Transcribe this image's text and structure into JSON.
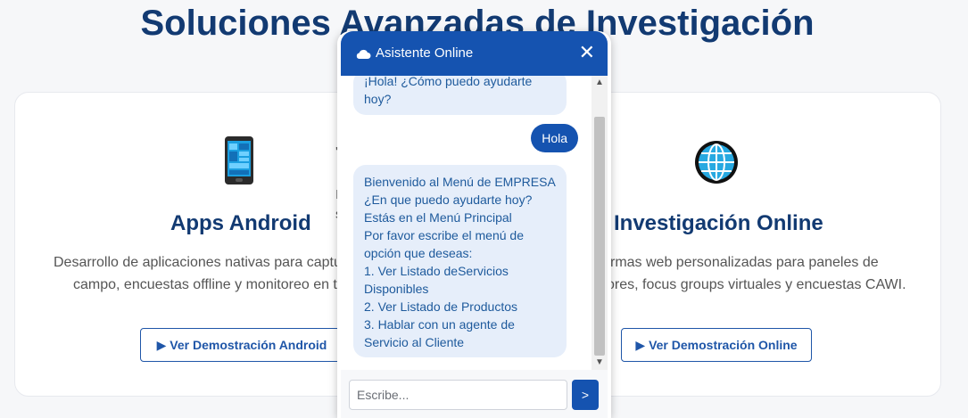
{
  "page": {
    "title": "Soluciones Avanzadas de Investigación"
  },
  "cards": {
    "left": {
      "icon": "mobile-phone-icon",
      "title": "Apps Android",
      "desc_line1": "Desarrollo de aplicaciones nativas para captu",
      "desc_line2": "campo, encuestas offline y monitoreo en t",
      "button": "▶ Ver Demostración Android"
    },
    "right": {
      "icon": "globe-icon",
      "title": "Investigación Online",
      "desc_line1": "rmas web personalizadas para paneles de",
      "desc_line2": "ores, focus groups virtuales y encuestas CAWI.",
      "button": "▶ Ver Demostración Online"
    },
    "middle_fragments": [
      "'",
      "I",
      "s"
    ]
  },
  "chat": {
    "header_icon": "cloud-icon",
    "title": "Asistente Online",
    "close": "✕",
    "messages": [
      {
        "from": "bot",
        "lines": [
          "¡Hola! ¿Cómo puedo ayudarte",
          "hoy?"
        ]
      },
      {
        "from": "user",
        "text": "Hola"
      },
      {
        "from": "bot",
        "lines": [
          "Bienvenido al Menú de EMPRESA",
          "¿En que puedo ayudarte hoy?",
          "Estás en el Menú Principal",
          "Por favor escribe el menú de",
          "opción que deseas:",
          "1. Ver Listado deServicios",
          "Disponibles",
          "2. Ver Listado de Productos",
          "3. Hablar con un agente de",
          "Servicio al Cliente"
        ]
      }
    ],
    "input_placeholder": "Escribe...",
    "send": ">",
    "colors": {
      "primary": "#1553b0",
      "bubble_bot": "#e6eefa",
      "bot_text": "#1e5a9c"
    }
  }
}
